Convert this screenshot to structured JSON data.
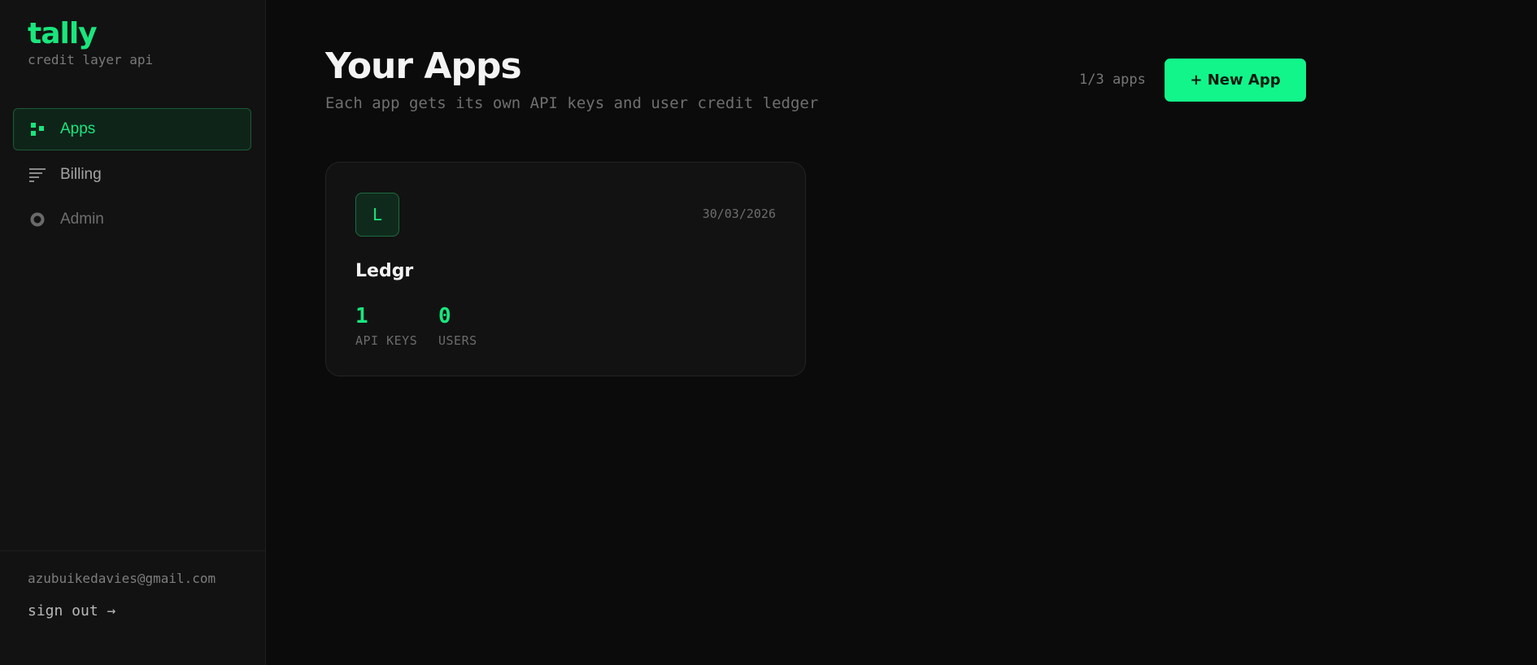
{
  "brand": {
    "name": "tally",
    "tagline": "credit layer api",
    "accent_color": "#19e67d"
  },
  "sidebar": {
    "items": [
      {
        "label": "Apps",
        "icon": "grid-icon",
        "active": true
      },
      {
        "label": "Billing",
        "icon": "list-lines-icon",
        "active": false
      },
      {
        "label": "Admin",
        "icon": "ring-icon",
        "active": false
      }
    ],
    "user_email": "azubuikedavies@gmail.com",
    "sign_out_label": "sign out →"
  },
  "header": {
    "title": "Your Apps",
    "subtitle": "Each app gets its own API keys and user credit ledger",
    "app_count": "1/3 apps",
    "new_app_label": "+ New App",
    "button_color": "#12f58a"
  },
  "apps": [
    {
      "initial": "L",
      "name": "Ledgr",
      "date": "30/03/2026",
      "stats": [
        {
          "value": "1",
          "label": "API KEYS"
        },
        {
          "value": "0",
          "label": "USERS"
        }
      ]
    }
  ]
}
